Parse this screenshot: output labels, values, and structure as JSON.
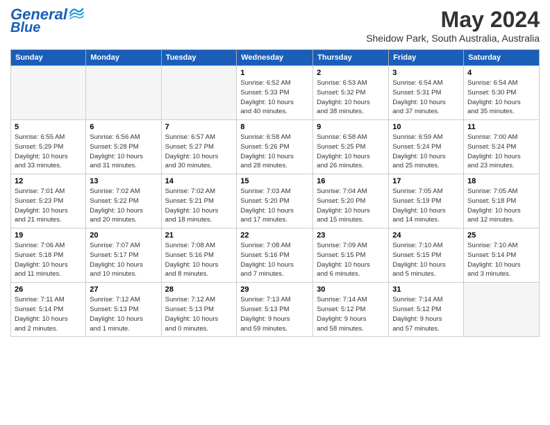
{
  "header": {
    "logo_general": "General",
    "logo_blue": "Blue",
    "month_title": "May 2024",
    "location": "Sheidow Park, South Australia, Australia"
  },
  "days_of_week": [
    "Sunday",
    "Monday",
    "Tuesday",
    "Wednesday",
    "Thursday",
    "Friday",
    "Saturday"
  ],
  "weeks": [
    {
      "days": [
        {
          "num": "",
          "info": "",
          "empty": true
        },
        {
          "num": "",
          "info": "",
          "empty": true
        },
        {
          "num": "",
          "info": "",
          "empty": true
        },
        {
          "num": "1",
          "info": "Sunrise: 6:52 AM\nSunset: 5:33 PM\nDaylight: 10 hours\nand 40 minutes."
        },
        {
          "num": "2",
          "info": "Sunrise: 6:53 AM\nSunset: 5:32 PM\nDaylight: 10 hours\nand 38 minutes."
        },
        {
          "num": "3",
          "info": "Sunrise: 6:54 AM\nSunset: 5:31 PM\nDaylight: 10 hours\nand 37 minutes."
        },
        {
          "num": "4",
          "info": "Sunrise: 6:54 AM\nSunset: 5:30 PM\nDaylight: 10 hours\nand 35 minutes."
        }
      ]
    },
    {
      "days": [
        {
          "num": "5",
          "info": "Sunrise: 6:55 AM\nSunset: 5:29 PM\nDaylight: 10 hours\nand 33 minutes."
        },
        {
          "num": "6",
          "info": "Sunrise: 6:56 AM\nSunset: 5:28 PM\nDaylight: 10 hours\nand 31 minutes."
        },
        {
          "num": "7",
          "info": "Sunrise: 6:57 AM\nSunset: 5:27 PM\nDaylight: 10 hours\nand 30 minutes."
        },
        {
          "num": "8",
          "info": "Sunrise: 6:58 AM\nSunset: 5:26 PM\nDaylight: 10 hours\nand 28 minutes."
        },
        {
          "num": "9",
          "info": "Sunrise: 6:58 AM\nSunset: 5:25 PM\nDaylight: 10 hours\nand 26 minutes."
        },
        {
          "num": "10",
          "info": "Sunrise: 6:59 AM\nSunset: 5:24 PM\nDaylight: 10 hours\nand 25 minutes."
        },
        {
          "num": "11",
          "info": "Sunrise: 7:00 AM\nSunset: 5:24 PM\nDaylight: 10 hours\nand 23 minutes."
        }
      ]
    },
    {
      "days": [
        {
          "num": "12",
          "info": "Sunrise: 7:01 AM\nSunset: 5:23 PM\nDaylight: 10 hours\nand 21 minutes."
        },
        {
          "num": "13",
          "info": "Sunrise: 7:02 AM\nSunset: 5:22 PM\nDaylight: 10 hours\nand 20 minutes."
        },
        {
          "num": "14",
          "info": "Sunrise: 7:02 AM\nSunset: 5:21 PM\nDaylight: 10 hours\nand 18 minutes."
        },
        {
          "num": "15",
          "info": "Sunrise: 7:03 AM\nSunset: 5:20 PM\nDaylight: 10 hours\nand 17 minutes."
        },
        {
          "num": "16",
          "info": "Sunrise: 7:04 AM\nSunset: 5:20 PM\nDaylight: 10 hours\nand 15 minutes."
        },
        {
          "num": "17",
          "info": "Sunrise: 7:05 AM\nSunset: 5:19 PM\nDaylight: 10 hours\nand 14 minutes."
        },
        {
          "num": "18",
          "info": "Sunrise: 7:05 AM\nSunset: 5:18 PM\nDaylight: 10 hours\nand 12 minutes."
        }
      ]
    },
    {
      "days": [
        {
          "num": "19",
          "info": "Sunrise: 7:06 AM\nSunset: 5:18 PM\nDaylight: 10 hours\nand 11 minutes."
        },
        {
          "num": "20",
          "info": "Sunrise: 7:07 AM\nSunset: 5:17 PM\nDaylight: 10 hours\nand 10 minutes."
        },
        {
          "num": "21",
          "info": "Sunrise: 7:08 AM\nSunset: 5:16 PM\nDaylight: 10 hours\nand 8 minutes."
        },
        {
          "num": "22",
          "info": "Sunrise: 7:08 AM\nSunset: 5:16 PM\nDaylight: 10 hours\nand 7 minutes."
        },
        {
          "num": "23",
          "info": "Sunrise: 7:09 AM\nSunset: 5:15 PM\nDaylight: 10 hours\nand 6 minutes."
        },
        {
          "num": "24",
          "info": "Sunrise: 7:10 AM\nSunset: 5:15 PM\nDaylight: 10 hours\nand 5 minutes."
        },
        {
          "num": "25",
          "info": "Sunrise: 7:10 AM\nSunset: 5:14 PM\nDaylight: 10 hours\nand 3 minutes."
        }
      ]
    },
    {
      "days": [
        {
          "num": "26",
          "info": "Sunrise: 7:11 AM\nSunset: 5:14 PM\nDaylight: 10 hours\nand 2 minutes."
        },
        {
          "num": "27",
          "info": "Sunrise: 7:12 AM\nSunset: 5:13 PM\nDaylight: 10 hours\nand 1 minute."
        },
        {
          "num": "28",
          "info": "Sunrise: 7:12 AM\nSunset: 5:13 PM\nDaylight: 10 hours\nand 0 minutes."
        },
        {
          "num": "29",
          "info": "Sunrise: 7:13 AM\nSunset: 5:13 PM\nDaylight: 9 hours\nand 59 minutes."
        },
        {
          "num": "30",
          "info": "Sunrise: 7:14 AM\nSunset: 5:12 PM\nDaylight: 9 hours\nand 58 minutes."
        },
        {
          "num": "31",
          "info": "Sunrise: 7:14 AM\nSunset: 5:12 PM\nDaylight: 9 hours\nand 57 minutes."
        },
        {
          "num": "",
          "info": "",
          "empty": true
        }
      ]
    }
  ]
}
